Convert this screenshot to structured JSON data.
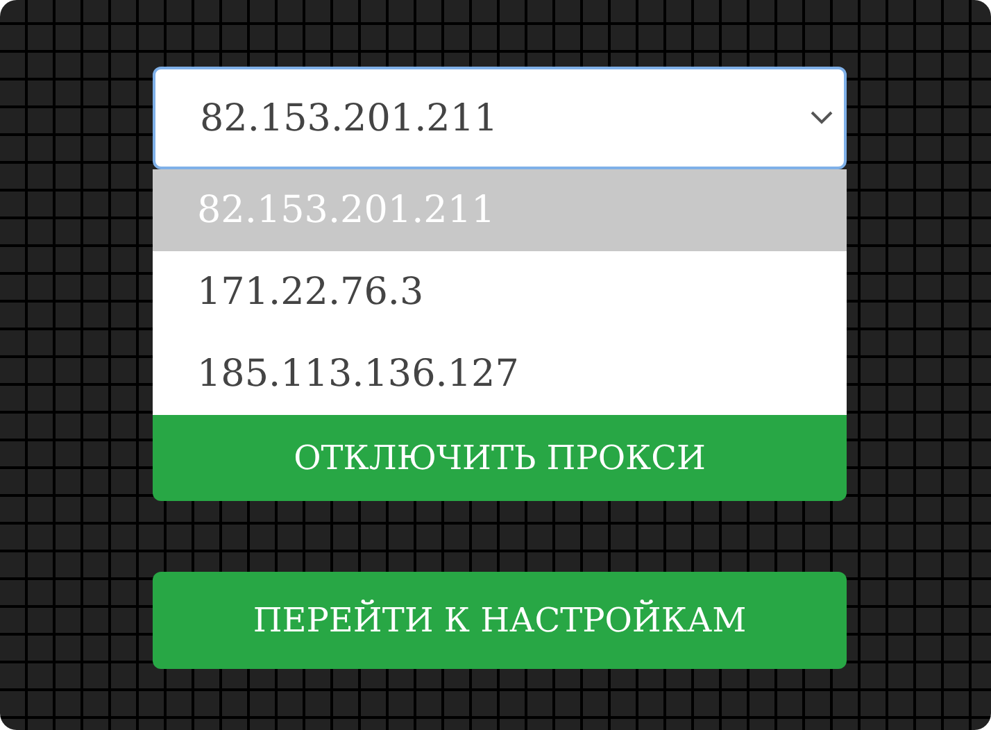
{
  "select": {
    "value": "82.153.201.211"
  },
  "options": [
    {
      "label": "82.153.201.211",
      "selected": true
    },
    {
      "label": "171.22.76.3",
      "selected": false
    },
    {
      "label": "185.113.136.127",
      "selected": false
    }
  ],
  "buttons": [
    {
      "label": "ОТКЛЮЧИТЬ ПРОКСИ"
    },
    {
      "label": "ПЕРЕЙТИ К НАСТРОЙКАМ"
    }
  ]
}
